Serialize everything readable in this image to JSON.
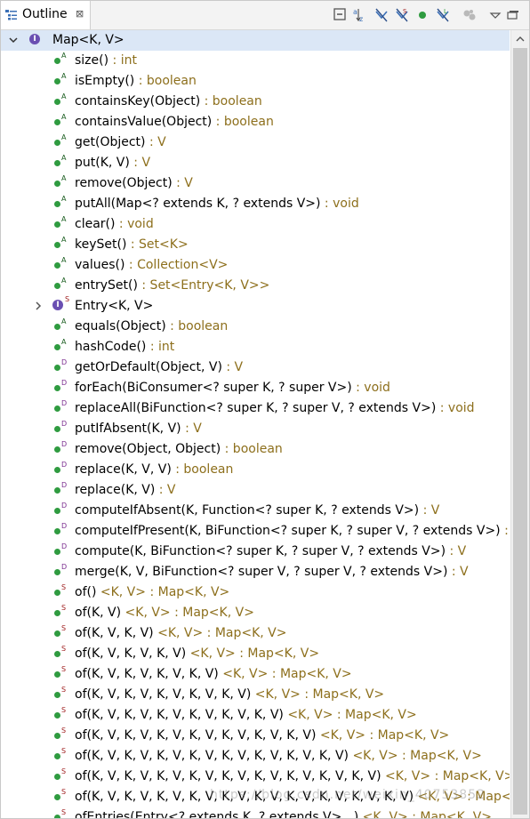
{
  "tab": {
    "label": "Outline",
    "close_glyph": "⊠"
  },
  "toolbar": [
    {
      "name": "collapse-all-icon"
    },
    {
      "name": "sort-alphabetically-icon"
    },
    {
      "name": "hide-fields-icon"
    },
    {
      "name": "hide-static-members-icon"
    },
    {
      "name": "hide-non-public-members-icon"
    },
    {
      "name": "hide-local-types-icon"
    },
    {
      "name": "focus-active-task-icon"
    },
    {
      "name": "view-menu-icon"
    },
    {
      "name": "minimize-icon"
    }
  ],
  "root": {
    "label": "Map<K, V>"
  },
  "members": [
    {
      "name": "size()",
      "ret": " : int",
      "mark": "A"
    },
    {
      "name": "isEmpty()",
      "ret": " : boolean",
      "mark": "A"
    },
    {
      "name": "containsKey(Object)",
      "ret": " : boolean",
      "mark": "A"
    },
    {
      "name": "containsValue(Object)",
      "ret": " : boolean",
      "mark": "A"
    },
    {
      "name": "get(Object)",
      "ret": " : V",
      "mark": "A"
    },
    {
      "name": "put(K, V)",
      "ret": " : V",
      "mark": "A"
    },
    {
      "name": "remove(Object)",
      "ret": " : V",
      "mark": "A"
    },
    {
      "name": "putAll(Map<? extends K, ? extends V>)",
      "ret": " : void",
      "mark": "A"
    },
    {
      "name": "clear()",
      "ret": " : void",
      "mark": "A"
    },
    {
      "name": "keySet()",
      "ret": " : Set<K>",
      "mark": "A"
    },
    {
      "name": "values()",
      "ret": " : Collection<V>",
      "mark": "A"
    },
    {
      "name": "entrySet()",
      "ret": " : Set<Entry<K, V>>",
      "mark": "A"
    },
    {
      "name": "Entry<K, V>",
      "ret": "",
      "mark": "S",
      "kind": "type"
    },
    {
      "name": "equals(Object)",
      "ret": " : boolean",
      "mark": "A"
    },
    {
      "name": "hashCode()",
      "ret": " : int",
      "mark": "A"
    },
    {
      "name": "getOrDefault(Object, V)",
      "ret": " : V",
      "mark": "D"
    },
    {
      "name": "forEach(BiConsumer<? super K, ? super V>)",
      "ret": " : void",
      "mark": "D"
    },
    {
      "name": "replaceAll(BiFunction<? super K, ? super V, ? extends V>)",
      "ret": " : void",
      "mark": "D"
    },
    {
      "name": "putIfAbsent(K, V)",
      "ret": " : V",
      "mark": "D"
    },
    {
      "name": "remove(Object, Object)",
      "ret": " : boolean",
      "mark": "D"
    },
    {
      "name": "replace(K, V, V)",
      "ret": " : boolean",
      "mark": "D"
    },
    {
      "name": "replace(K, V)",
      "ret": " : V",
      "mark": "D"
    },
    {
      "name": "computeIfAbsent(K, Function<? super K, ? extends V>)",
      "ret": " : V",
      "mark": "D"
    },
    {
      "name": "computeIfPresent(K, BiFunction<? super K, ? super V, ? extends V>)",
      "ret": " : V",
      "mark": "D"
    },
    {
      "name": "compute(K, BiFunction<? super K, ? super V, ? extends V>)",
      "ret": " : V",
      "mark": "D"
    },
    {
      "name": "merge(K, V, BiFunction<? super V, ? super V, ? extends V>)",
      "ret": " : V",
      "mark": "D"
    },
    {
      "name": "of()",
      "ret": " <K, V> : Map<K, V>",
      "mark": "S"
    },
    {
      "name": "of(K, V)",
      "ret": " <K, V> : Map<K, V>",
      "mark": "S"
    },
    {
      "name": "of(K, V, K, V)",
      "ret": " <K, V> : Map<K, V>",
      "mark": "S"
    },
    {
      "name": "of(K, V, K, V, K, V)",
      "ret": " <K, V> : Map<K, V>",
      "mark": "S"
    },
    {
      "name": "of(K, V, K, V, K, V, K, V)",
      "ret": " <K, V> : Map<K, V>",
      "mark": "S"
    },
    {
      "name": "of(K, V, K, V, K, V, K, V, K, V)",
      "ret": " <K, V> : Map<K, V>",
      "mark": "S"
    },
    {
      "name": "of(K, V, K, V, K, V, K, V, K, V, K, V)",
      "ret": " <K, V> : Map<K, V>",
      "mark": "S"
    },
    {
      "name": "of(K, V, K, V, K, V, K, V, K, V, K, V, K, V)",
      "ret": " <K, V> : Map<K, V>",
      "mark": "S"
    },
    {
      "name": "of(K, V, K, V, K, V, K, V, K, V, K, V, K, V, K, V)",
      "ret": " <K, V> : Map<K, V>",
      "mark": "S"
    },
    {
      "name": "of(K, V, K, V, K, V, K, V, K, V, K, V, K, V, K, V, K, V)",
      "ret": " <K, V> : Map<K, V>",
      "mark": "S"
    },
    {
      "name": "of(K, V, K, V, K, V, K, V, K, V, K, V, K, V, K, V, K, V, K, V)",
      "ret": " <K, V> : Map<K, V>",
      "mark": "S"
    },
    {
      "name": "ofEntries(Entry<? extends K, ? extends V>...)",
      "ret": " <K, V> : Map<K, V>",
      "mark": "S"
    }
  ],
  "watermark": "https://blog.csdn.net/weixin_40753852"
}
